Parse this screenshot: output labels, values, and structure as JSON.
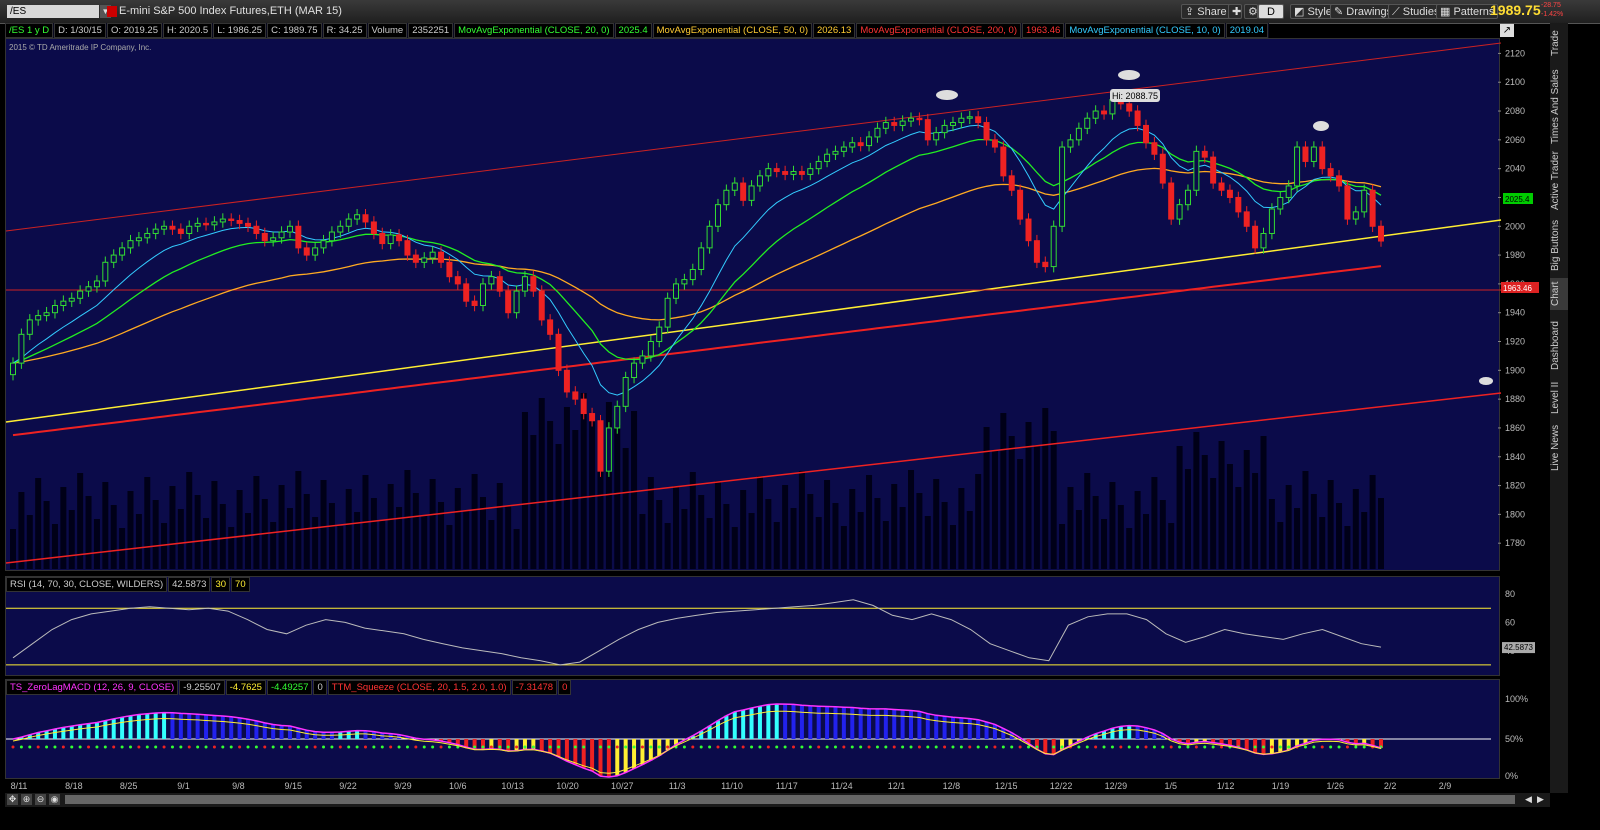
{
  "toolbar": {
    "symbol": "/ES",
    "instrument": "E-mini S&P 500 Index Futures,ETH (MAR 15)",
    "share": "Share",
    "style": "Style",
    "drawings": "Drawings",
    "studies": "Studies",
    "patterns": "Patterns",
    "last_price": "1989.75",
    "change_pts": "-28.75",
    "change_pct": "-1.42%",
    "color_up": "#00ff00",
    "color_down": "#ff3333"
  },
  "infobar": {
    "tf": "/ES 1 y D",
    "date": "D: 1/30/15",
    "open": "O: 2019.25",
    "high": "H: 2020.5",
    "low": "L: 1986.25",
    "close": "C: 1989.75",
    "range": "R: 34.25",
    "vol_label": "Volume",
    "vol_value": "2352251",
    "ma20_label": "MovAvgExponential (CLOSE, 20, 0)",
    "ma20_value": "2025.4",
    "ma50_label": "MovAvgExponential (CLOSE, 50, 0)",
    "ma50_value": "2026.13",
    "ma200_label": "MovAvgExponential (CLOSE, 200, 0)",
    "ma200_value": "1963.46",
    "ma10_label": "MovAvgExponential (CLOSE, 10, 0)",
    "ma10_value": "2019.04",
    "copyright": "2015 © TD Ameritrade IP Company, Inc."
  },
  "chart_data": [
    {
      "type": "candlestick",
      "ylim": [
        1760,
        2130
      ],
      "y_ticks": [
        1780,
        1800,
        1820,
        1840,
        1860,
        1880,
        1900,
        1920,
        1940,
        1960,
        1980,
        2000,
        2020,
        2040,
        2060,
        2080,
        2100,
        2120
      ],
      "x_ticks": [
        "8/11",
        "8/18",
        "8/25",
        "9/1",
        "9/8",
        "9/15",
        "9/22",
        "9/29",
        "10/6",
        "10/13",
        "10/20",
        "10/27",
        "11/3",
        "11/10",
        "11/17",
        "11/24",
        "12/1",
        "12/8",
        "12/15",
        "12/22",
        "12/29",
        "1/5",
        "1/12",
        "1/19",
        "1/26",
        "2/2",
        "2/9"
      ],
      "hi_label": "Hi: 2088.75",
      "price_tag": "2025.4",
      "ma200_tag": "1963.46",
      "closes": [
        1905,
        1925,
        1935,
        1938,
        1940,
        1945,
        1948,
        1950,
        1955,
        1958,
        1962,
        1975,
        1980,
        1985,
        1990,
        1992,
        1995,
        1998,
        2000,
        1998,
        1995,
        2000,
        2002,
        2001,
        2003,
        2005,
        2004,
        2002,
        2000,
        1995,
        1990,
        1992,
        1996,
        2000,
        1985,
        1980,
        1985,
        1990,
        1996,
        2000,
        2005,
        2008,
        2003,
        1995,
        1988,
        1994,
        1990,
        1980,
        1975,
        1978,
        1982,
        1975,
        1965,
        1960,
        1948,
        1945,
        1960,
        1965,
        1955,
        1940,
        1955,
        1965,
        1955,
        1935,
        1925,
        1900,
        1885,
        1880,
        1870,
        1865,
        1830,
        1860,
        1875,
        1895,
        1905,
        1910,
        1920,
        1930,
        1950,
        1960,
        1963,
        1970,
        1985,
        2000,
        2015,
        2025,
        2030,
        2018,
        2028,
        2035,
        2040,
        2038,
        2036,
        2038,
        2036,
        2040,
        2045,
        2050,
        2052,
        2055,
        2058,
        2056,
        2062,
        2068,
        2072,
        2070,
        2073,
        2075,
        2074,
        2060,
        2065,
        2070,
        2072,
        2075,
        2076,
        2072,
        2060,
        2055,
        2035,
        2025,
        2005,
        1990,
        1975,
        1972,
        2000,
        2055,
        2060,
        2068,
        2075,
        2080,
        2078,
        2088,
        2085,
        2080,
        2070,
        2058,
        2050,
        2030,
        2005,
        2015,
        2025,
        2052,
        2048,
        2030,
        2025,
        2020,
        2010,
        2000,
        1985,
        1995,
        2012,
        2020,
        2028,
        2055,
        2045,
        2055,
        2040,
        2035,
        2028,
        2005,
        2010,
        2025,
        2000,
        1989.75
      ],
      "volume_note": "volume histogram behind price bars"
    },
    {
      "type": "line",
      "name": "RSI (14, 70, 30, CLOSE, WILDERS)",
      "value": "42.5873",
      "levels": [
        30,
        70
      ],
      "y_ticks": [
        80,
        60,
        40
      ],
      "values": [
        35,
        45,
        55,
        62,
        66,
        68,
        70,
        71,
        70,
        69,
        70,
        68,
        62,
        55,
        52,
        58,
        62,
        60,
        56,
        54,
        52,
        48,
        45,
        42,
        40,
        38,
        35,
        33,
        30,
        32,
        40,
        48,
        55,
        60,
        63,
        65,
        67,
        68,
        69,
        70,
        71,
        72,
        74,
        76,
        72,
        65,
        62,
        66,
        62,
        55,
        45,
        40,
        35,
        33,
        58,
        64,
        66,
        66,
        62,
        52,
        46,
        50,
        55,
        52,
        50,
        48,
        52,
        55,
        50,
        45,
        42.5873
      ]
    },
    {
      "type": "bar",
      "name": "TS_ZeroLagMACD (12, 26, 9, CLOSE)",
      "values_text": [
        "-9.25507",
        "-4.7625",
        "-4.49257",
        "0"
      ],
      "squeeze_label": "TTM_Squeeze (CLOSE, 20, 1.5, 2.0, 1.0)",
      "squeeze_value": "-7.31478",
      "squeeze_zero": "0",
      "y_ticks": [
        "100%",
        "50%",
        "0%"
      ]
    }
  ],
  "sidebar": {
    "tabs": [
      "Trade",
      "Times And Sales",
      "Active Trader",
      "Big Buttons",
      "Chart",
      "Dashboard",
      "Level II",
      "Live News"
    ]
  }
}
